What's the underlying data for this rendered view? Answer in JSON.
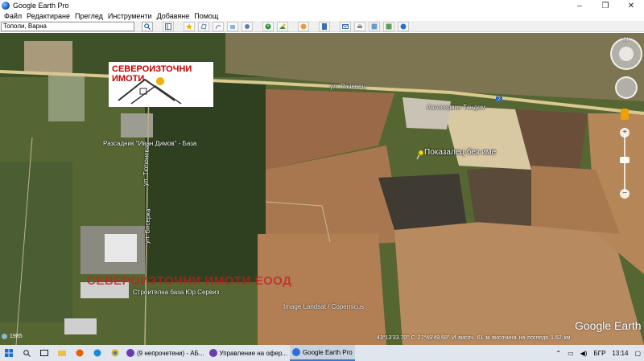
{
  "window": {
    "title": "Google Earth Pro",
    "minimize": "–",
    "maximize": "❐",
    "close": "✕"
  },
  "menu": [
    "Файл",
    "Редактиране",
    "Преглед",
    "Инструменти",
    "Добавяне",
    "Помощ"
  ],
  "search": {
    "value": "Тополи, Варна"
  },
  "map": {
    "road_label_1": "ул. Рачевец",
    "road_label_2": "Автосервиз Тандем",
    "road_label_3": "Разсадник \"Иван Димов\" - База",
    "road_label_4": "ул. Тютюнева",
    "road_label_5": "ул. Бисерка",
    "road_label_6": "Строителна база Юр Сервиз",
    "road_sign": "2",
    "placemark_label": "Показалец без име",
    "watermark": "СЕВЕРОИЗТОЧНИ ИМОТИ ЕООД",
    "copyright": "Image Landsat / Copernicus",
    "brand": "Google Earth",
    "history_year": "1985",
    "status": "43°13'33.70\" С   27°49'49.68\" И   височ.   61 м          височина на погледа   1.62 км"
  },
  "logo": {
    "text": "СЕВЕРОИЗТОЧНИ ИМОТИ"
  },
  "nav": {
    "north": "N",
    "zoom_in": "+",
    "zoom_out": "−"
  },
  "taskbar": {
    "apps": [
      {
        "label": "(9 непрочетени) - АБ...",
        "color": "#6a3ab2"
      },
      {
        "label": "Управление на офер...",
        "color": "#6a3ab2"
      },
      {
        "label": "Google Earth Pro",
        "color": "#2a6fd6"
      }
    ],
    "language": "БГР",
    "time": "13:14"
  }
}
